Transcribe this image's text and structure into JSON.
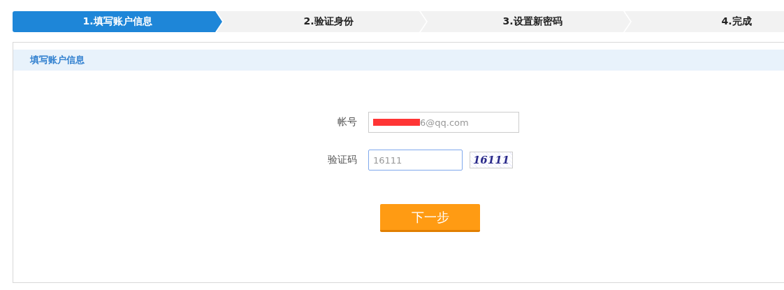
{
  "steps": [
    {
      "label": "1.填写账户信息",
      "selected": true
    },
    {
      "label": "2.验证身份",
      "selected": false
    },
    {
      "label": "3.设置新密码",
      "selected": false
    },
    {
      "label": "4.完成",
      "selected": false
    }
  ],
  "panel": {
    "title": "填写账户信息"
  },
  "form": {
    "fields": [
      {
        "kind": "account",
        "label": "帐号",
        "value": "6@qq.com",
        "redacted": true,
        "focused": false
      },
      {
        "kind": "captcha",
        "label": "验证码",
        "value": "16111",
        "focused": true,
        "captcha": "16111"
      }
    ],
    "submit": "下一步"
  }
}
